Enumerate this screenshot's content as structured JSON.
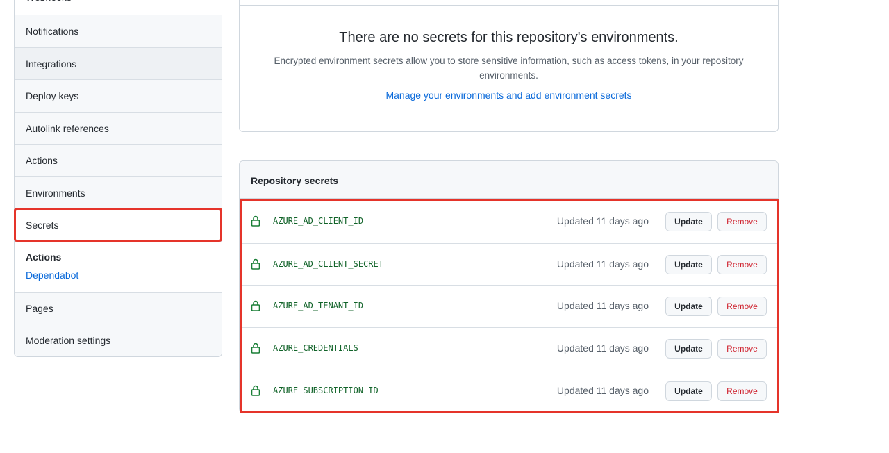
{
  "sidebar": {
    "items_top": [
      {
        "label": "Webhooks"
      },
      {
        "label": "Notifications"
      },
      {
        "label": "Integrations"
      },
      {
        "label": "Deploy keys"
      },
      {
        "label": "Autolink references"
      },
      {
        "label": "Actions"
      },
      {
        "label": "Environments"
      },
      {
        "label": "Secrets"
      }
    ],
    "group_title": "Actions",
    "group_link": "Dependabot",
    "items_bottom": [
      {
        "label": "Pages"
      },
      {
        "label": "Moderation settings"
      }
    ]
  },
  "environments": {
    "title": "There are no secrets for this repository's environments.",
    "text": "Encrypted environment secrets allow you to store sensitive information, such as access tokens, in your repository environments.",
    "link": "Manage your environments and add environment secrets"
  },
  "repo_secrets": {
    "header": "Repository secrets",
    "update_label": "Update",
    "remove_label": "Remove",
    "rows": [
      {
        "name": "AZURE_AD_CLIENT_ID",
        "updated": "Updated 11 days ago"
      },
      {
        "name": "AZURE_AD_CLIENT_SECRET",
        "updated": "Updated 11 days ago"
      },
      {
        "name": "AZURE_AD_TENANT_ID",
        "updated": "Updated 11 days ago"
      },
      {
        "name": "AZURE_CREDENTIALS",
        "updated": "Updated 11 days ago"
      },
      {
        "name": "AZURE_SUBSCRIPTION_ID",
        "updated": "Updated 11 days ago"
      }
    ]
  },
  "colors": {
    "highlight": "#e5342a",
    "link": "#0969da",
    "secret_name": "#116329",
    "danger": "#cf222e"
  }
}
